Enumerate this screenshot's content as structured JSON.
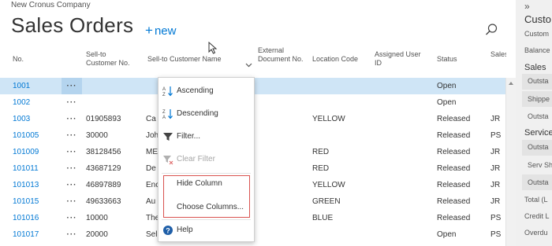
{
  "company": "New Cronus Company",
  "page_title": "Sales Orders",
  "new_action": {
    "plus": "+",
    "label": "new"
  },
  "columns": {
    "no": "No.",
    "sell_to_no": "Sell-to Customer No.",
    "sell_to_name": "Sell-to Customer Name",
    "ext_doc": "External Document No.",
    "location": "Location Code",
    "assigned_user": "Assigned User ID",
    "status": "Status",
    "salesperson": "Salesperson Code"
  },
  "row_dots": "···",
  "rows": [
    {
      "no": "1001",
      "cust": "",
      "name": "",
      "loc": "",
      "status": "Open",
      "sp": "",
      "selected": true
    },
    {
      "no": "1002",
      "cust": "",
      "name": "",
      "loc": "",
      "status": "Open",
      "sp": ""
    },
    {
      "no": "1003",
      "cust": "01905893",
      "name": "Ca",
      "loc": "YELLOW",
      "status": "Released",
      "sp": "JR"
    },
    {
      "no": "101005",
      "cust": "30000",
      "name": "Joh",
      "loc": "",
      "status": "Released",
      "sp": "PS"
    },
    {
      "no": "101009",
      "cust": "38128456",
      "name": "ME",
      "loc": "RED",
      "status": "Released",
      "sp": "JR"
    },
    {
      "no": "101011",
      "cust": "43687129",
      "name": "De",
      "loc": "RED",
      "status": "Released",
      "sp": "JR"
    },
    {
      "no": "101013",
      "cust": "46897889",
      "name": "Enc",
      "loc": "YELLOW",
      "status": "Released",
      "sp": "JR"
    },
    {
      "no": "101015",
      "cust": "49633663",
      "name": "Au",
      "loc": "GREEN",
      "status": "Released",
      "sp": "JR"
    },
    {
      "no": "101016",
      "cust": "10000",
      "name": "The",
      "loc": "BLUE",
      "status": "Released",
      "sp": "PS"
    },
    {
      "no": "101017",
      "cust": "20000",
      "name": "Sel",
      "loc": "",
      "status": "Open",
      "sp": "PS"
    }
  ],
  "column_menu": {
    "ascending": "Ascending",
    "descending": "Descending",
    "filter": "Filter...",
    "clear_filter": "Clear Filter",
    "hide_column": "Hide Column",
    "choose_columns": "Choose Columns...",
    "help": "Help"
  },
  "factbox": {
    "collapse": "»",
    "title": "Custo",
    "items": [
      "Custom",
      "Balance"
    ],
    "sales_heading": "Sales",
    "sales_items": [
      "Outsta",
      "Shippe",
      "Outsta"
    ],
    "service_heading": "Service",
    "service_items": [
      "Outsta",
      "Serv Sh",
      "Outsta"
    ],
    "footer_items": [
      "Total (L",
      "Credit L",
      "Overdu"
    ]
  },
  "colors": {
    "accent": "#0078d4",
    "selected_row": "#cfe5f6",
    "highlight_box": "#d9534f"
  }
}
